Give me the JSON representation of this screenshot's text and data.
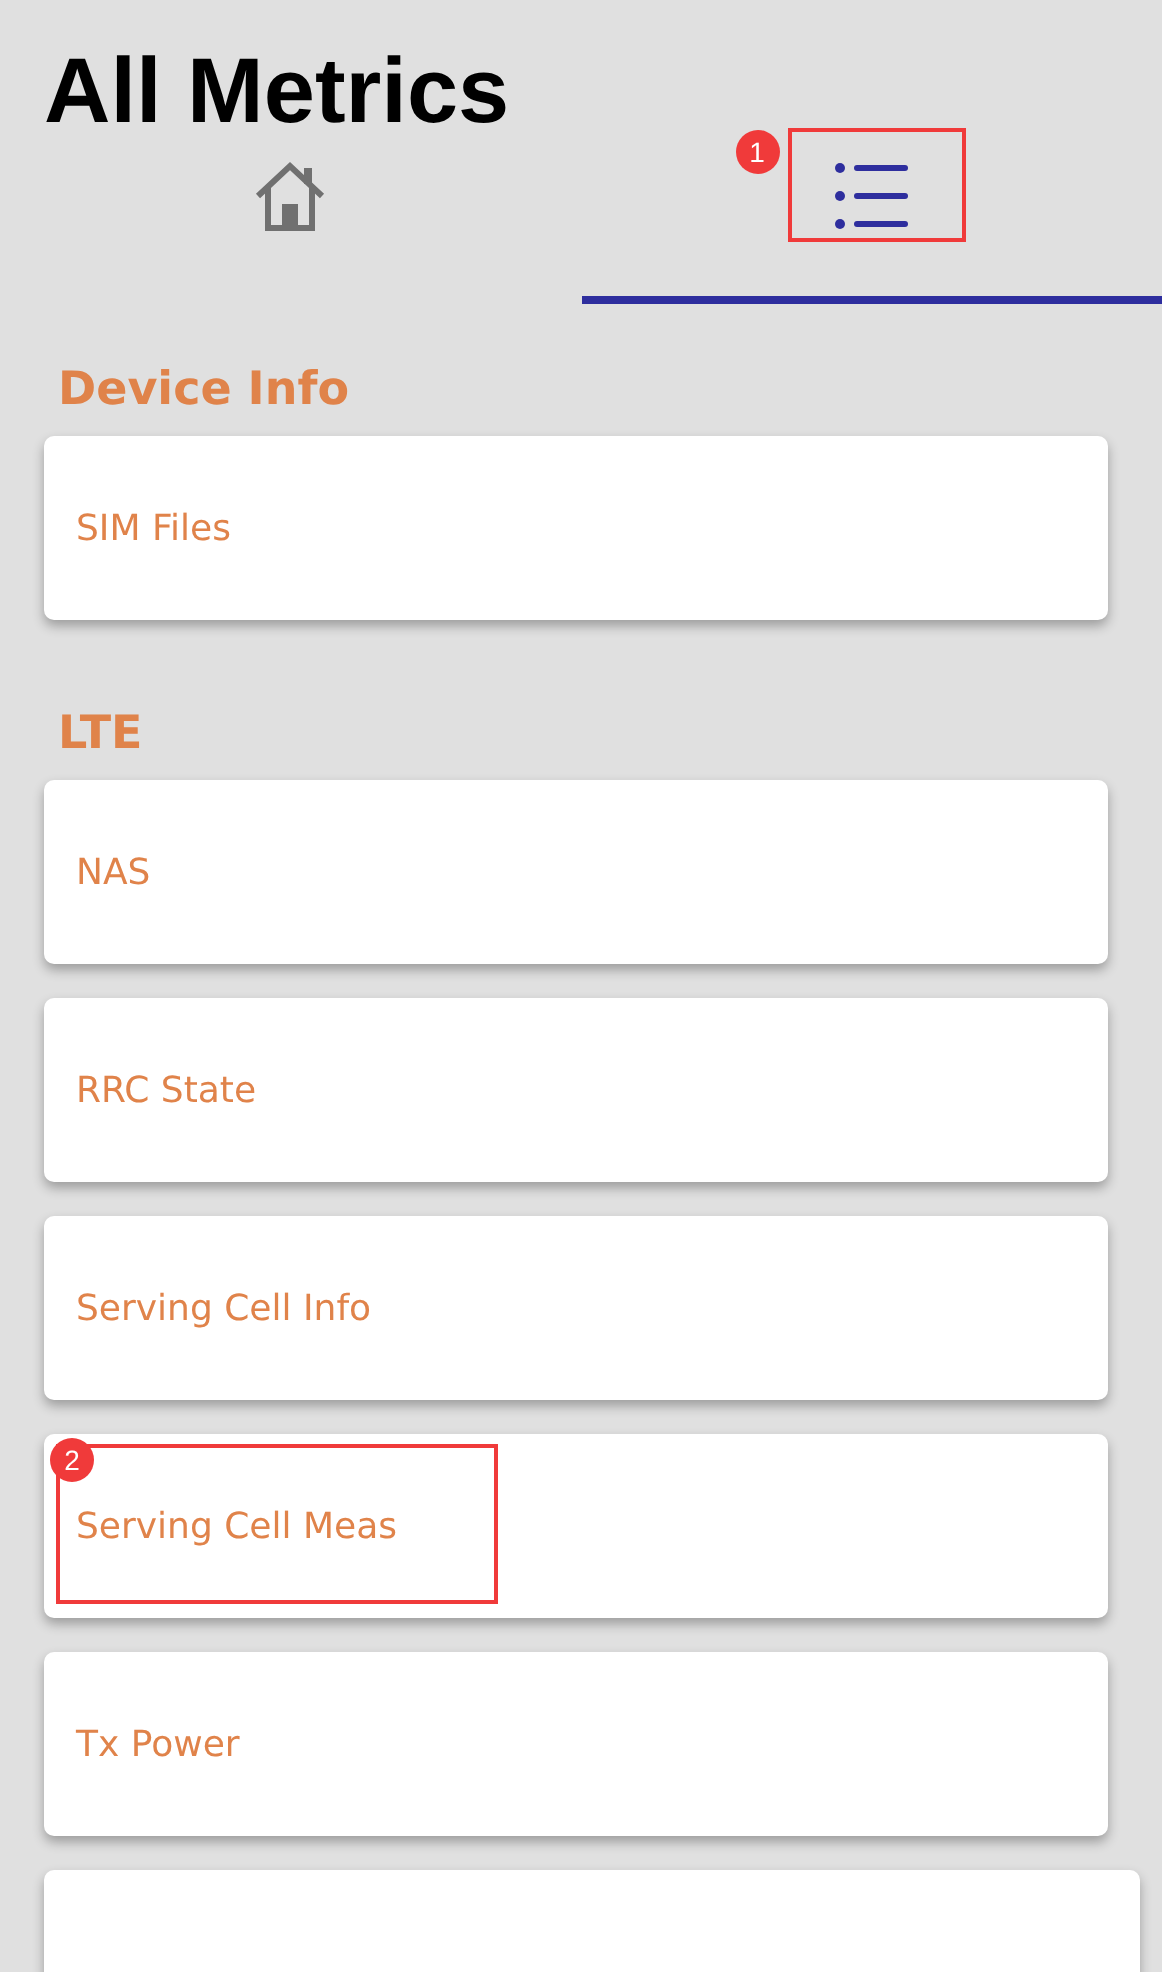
{
  "title": "All Metrics",
  "tabs": [
    {
      "kind": "home",
      "selected": false
    },
    {
      "kind": "list",
      "selected": true,
      "callout": "1"
    }
  ],
  "sections": [
    {
      "header": "Device Info",
      "items": [
        {
          "label": "SIM Files"
        }
      ]
    },
    {
      "header": "LTE",
      "more_below": true,
      "items": [
        {
          "label": "NAS"
        },
        {
          "label": "RRC State"
        },
        {
          "label": "Serving Cell Info"
        },
        {
          "label": "Serving Cell Meas",
          "callout": "2"
        },
        {
          "label": "Tx Power"
        }
      ]
    }
  ]
}
